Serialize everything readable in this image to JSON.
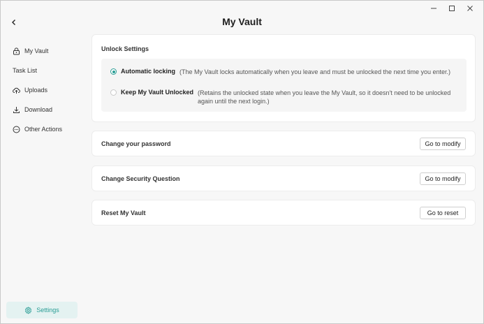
{
  "window": {
    "minimize": "—",
    "maximize": "☐",
    "close": "✕"
  },
  "header": {
    "title": "My Vault"
  },
  "sidebar": {
    "items": [
      {
        "label": "My Vault",
        "icon": "lock-icon"
      },
      {
        "label": "Task List",
        "icon": ""
      },
      {
        "label": "Uploads",
        "icon": "upload-cloud-icon"
      },
      {
        "label": "Download",
        "icon": "download-icon"
      },
      {
        "label": "Other Actions",
        "icon": "more-circle-icon"
      }
    ],
    "settings": {
      "label": "Settings",
      "icon": "gear-icon",
      "color": "#2a9d95"
    }
  },
  "unlock": {
    "title": "Unlock Settings",
    "options": [
      {
        "label": "Automatic locking",
        "description": "(The My Vault locks automatically when you leave and must be unlocked the next time you enter.)",
        "checked": true
      },
      {
        "label": "Keep My Vault Unlocked",
        "description": "(Retains the unlocked state when you leave the My Vault, so it doesn't need to be unlocked again until the next login.)",
        "checked": false
      }
    ]
  },
  "password": {
    "title": "Change your password",
    "button": "Go to modify"
  },
  "security": {
    "title": "Change Security Question",
    "button": "Go to modify"
  },
  "reset": {
    "title": "Reset My Vault",
    "button": "Go to reset"
  },
  "colors": {
    "accent": "#2a9d95",
    "accent_bg": "#e4f2f1"
  }
}
